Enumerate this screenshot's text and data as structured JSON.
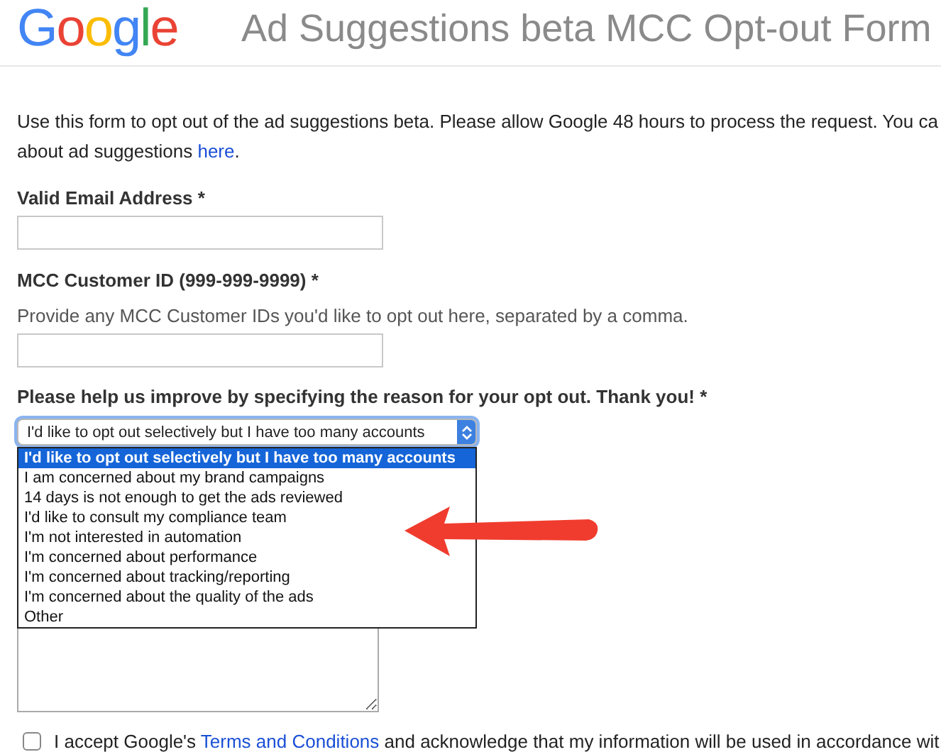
{
  "header": {
    "logo": "Google",
    "title": "Ad Suggestions beta MCC Opt-out Form"
  },
  "intro": {
    "line1": "Use this form to opt out of the ad suggestions beta. Please allow Google 48 hours to process the request. You ca",
    "line2": "about ad suggestions ",
    "link": "here",
    "end": "."
  },
  "fields": [
    {
      "kind": "input",
      "label": "Valid Email Address *"
    },
    {
      "kind": "input",
      "label": "MCC Customer ID (999-999-9999) *",
      "help": "Provide any MCC Customer IDs you'd like to opt out here, separated by a comma."
    },
    {
      "kind": "select",
      "label": "Please help us improve by specifying the reason for your opt out. Thank you! *",
      "value": "I'd like to opt out selectively but I have too many accounts",
      "expanded": true,
      "options": [
        {
          "label": "I'd like to opt out selectively but I have too many accounts",
          "selected": true
        },
        {
          "label": "I am concerned about my brand campaigns",
          "selected": false
        },
        {
          "label": "14 days is not enough to get the ads reviewed",
          "selected": false
        },
        {
          "label": "I'd like to consult my compliance team",
          "selected": false
        },
        {
          "label": "I'm not interested in automation",
          "selected": false
        },
        {
          "label": "I'm concerned about performance",
          "selected": false
        },
        {
          "label": "I'm concerned about tracking/reporting",
          "selected": false
        },
        {
          "label": "I'm concerned about the quality of the ads",
          "selected": false
        },
        {
          "label": "Other",
          "selected": false
        }
      ]
    },
    {
      "kind": "textarea"
    }
  ],
  "consent": {
    "checked": false,
    "text": "I accept Google's ",
    "link": "Terms and Conditions",
    "rest": " and acknowledge that my information will be used in accordance wit"
  }
}
